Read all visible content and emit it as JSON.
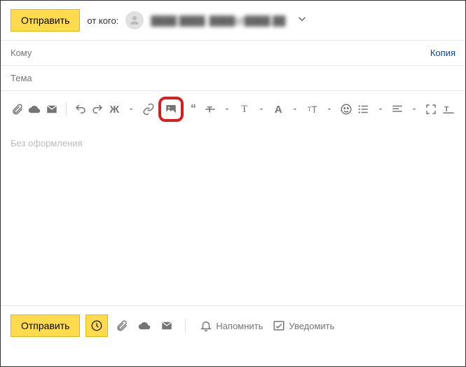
{
  "header": {
    "send_label": "Отправить",
    "from_label": "от кого:",
    "from_name": "████ ████",
    "from_email": "████@████.██"
  },
  "fields": {
    "to_placeholder": "Кому",
    "copy_label": "Копия",
    "subject_placeholder": "Тема"
  },
  "body": {
    "placeholder": "Без оформления"
  },
  "toolbar": {
    "bold_glyph": "Ж",
    "quote_glyph": "“",
    "font_label": "A",
    "fs1": "T",
    "fs2": "T",
    "tt_label": "T"
  },
  "footer": {
    "send_label": "Отправить",
    "remind_label": "Напомнить",
    "notify_label": "Уведомить"
  }
}
